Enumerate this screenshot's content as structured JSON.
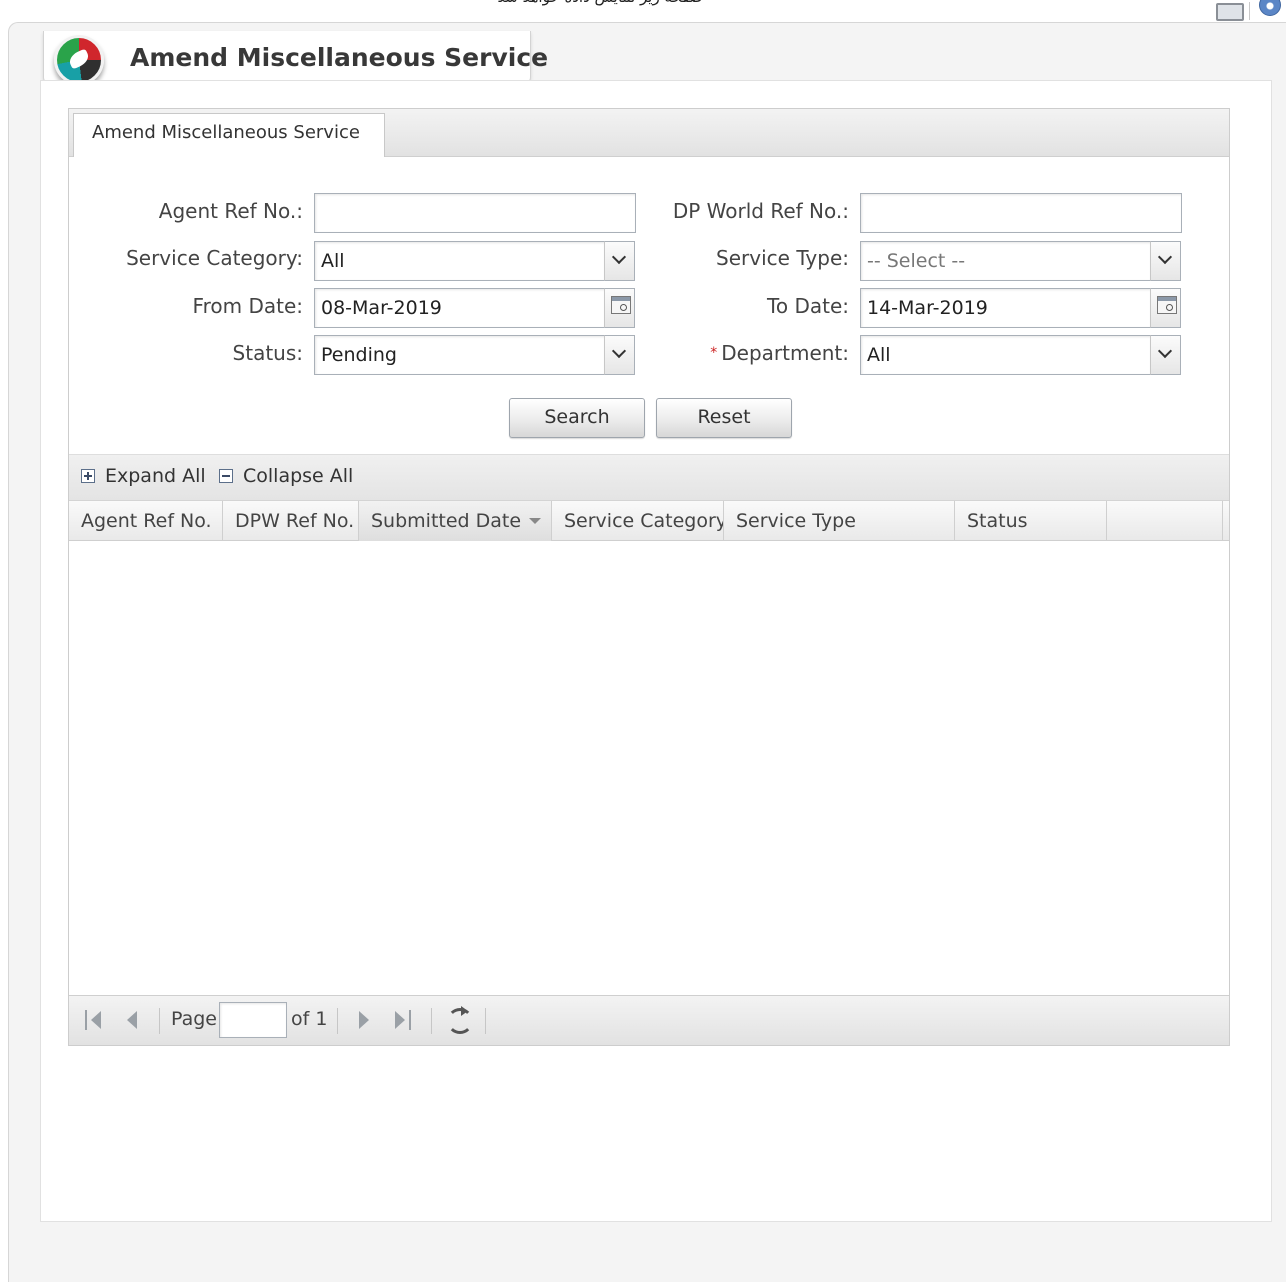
{
  "top_caption": "صفحة زیر نمایش داده خواهد شد",
  "app": {
    "title": "Amend Miscellaneous Service"
  },
  "tab": {
    "label": "Amend Miscellaneous Service"
  },
  "form": {
    "agent_ref": {
      "label": "Agent Ref No.:",
      "value": ""
    },
    "dpw_ref": {
      "label": "DP World Ref No.:",
      "value": ""
    },
    "service_category": {
      "label": "Service Category:",
      "value": "All"
    },
    "service_type": {
      "label": "Service Type:",
      "placeholder": "-- Select --"
    },
    "from_date": {
      "label": "From Date:",
      "value": "08-Mar-2019"
    },
    "to_date": {
      "label": "To Date:",
      "value": "14-Mar-2019"
    },
    "status": {
      "label": "Status:",
      "value": "Pending"
    },
    "department": {
      "label": "Department:",
      "required_mark": "*",
      "value": "All"
    },
    "search_label": "Search",
    "reset_label": "Reset"
  },
  "toolbar": {
    "expand_all": "Expand All",
    "collapse_all": "Collapse All"
  },
  "grid": {
    "columns": [
      "Agent Ref No.",
      "DPW Ref No.",
      "Submitted Date",
      "Service Category",
      "Service Type",
      "Status",
      ""
    ],
    "sorted_column": "Submitted Date",
    "rows": []
  },
  "paging": {
    "page_label": "Page",
    "page_value": "",
    "of_label": "of 1"
  },
  "icons": [
    "printer-icon",
    "help-icon",
    "logo-icon",
    "chevron-down-icon",
    "calendar-icon",
    "plus-box-icon",
    "minus-box-icon",
    "sort-desc-icon",
    "first-page-icon",
    "prev-page-icon",
    "next-page-icon",
    "last-page-icon",
    "refresh-icon"
  ]
}
